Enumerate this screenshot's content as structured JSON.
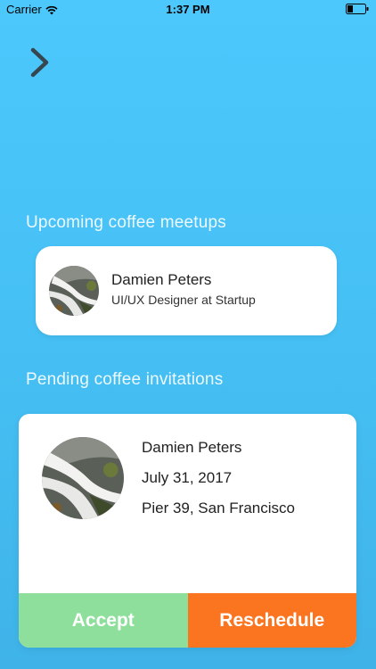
{
  "status_bar": {
    "carrier": "Carrier",
    "time": "1:37 PM"
  },
  "colors": {
    "background_top": "#4cc8fd",
    "background_bottom": "#3fb3e8",
    "accept": "#8fdf9c",
    "reschedule": "#fb7521"
  },
  "nav": {
    "forward_icon": "chevron-right-icon"
  },
  "upcoming": {
    "title": "Upcoming coffee meetups",
    "person": {
      "name": "Damien Peters",
      "role": "UI/UX Designer at Startup",
      "avatar_icon": "waterfall-photo"
    }
  },
  "pending": {
    "title": "Pending coffee invitations",
    "invitation": {
      "name": "Damien Peters",
      "date": "July 31, 2017",
      "location": "Pier 39, San Francisco",
      "avatar_icon": "waterfall-photo"
    },
    "accept_label": "Accept",
    "reschedule_label": "Reschedule"
  }
}
